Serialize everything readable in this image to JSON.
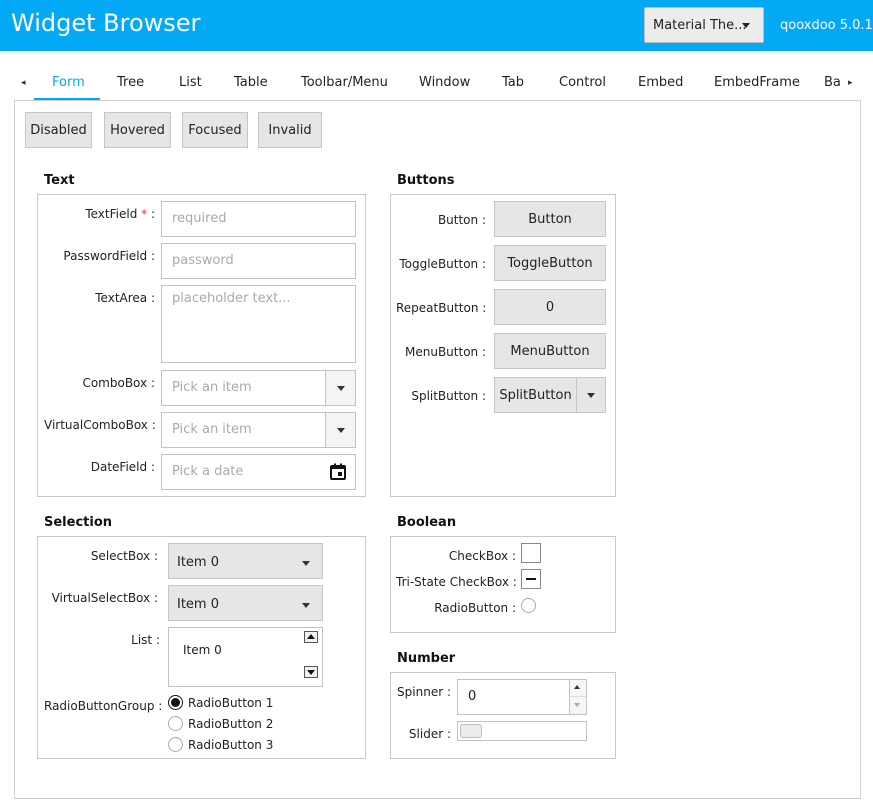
{
  "header": {
    "title": "Widget Browser",
    "theme_select": "Material The...",
    "version": "qooxdoo 5.0.1"
  },
  "tabs": [
    "Form",
    "Tree",
    "List",
    "Table",
    "Toolbar/Menu",
    "Window",
    "Tab",
    "Control",
    "Embed",
    "EmbedFrame",
    "Ba"
  ],
  "tab_scroll": {
    "left": "◂",
    "right": "▸"
  },
  "state_buttons": [
    "Disabled",
    "Hovered",
    "Focused",
    "Invalid"
  ],
  "text_group": {
    "title": "Text",
    "textfield_label": "TextField",
    "required_marker": "*",
    "label_suffix": " :",
    "textfield_placeholder": "required",
    "password_label": "PasswordField :",
    "password_placeholder": "password",
    "textarea_label": "TextArea :",
    "textarea_placeholder": "placeholder text...",
    "combobox_label": "ComboBox :",
    "combobox_placeholder": "Pick an item",
    "virtualcombobox_label": "VirtualComboBox :",
    "virtualcombobox_placeholder": "Pick an item",
    "datefield_label": "DateField :",
    "datefield_placeholder": "Pick a date"
  },
  "buttons_group": {
    "title": "Buttons",
    "button_label": "Button :",
    "button_text": "Button",
    "toggle_label": "ToggleButton :",
    "toggle_text": "ToggleButton",
    "repeat_label": "RepeatButton :",
    "repeat_text": "0",
    "menu_label": "MenuButton :",
    "menu_text": "MenuButton",
    "split_label": "SplitButton :",
    "split_text": "SplitButton"
  },
  "selection_group": {
    "title": "Selection",
    "selectbox_label": "SelectBox :",
    "selectbox_value": "Item 0",
    "virtualselectbox_label": "VirtualSelectBox :",
    "virtualselectbox_value": "Item 0",
    "list_label": "List :",
    "list_item": "Item 0",
    "radiogroup_label": "RadioButtonGroup :",
    "radios": [
      "RadioButton 1",
      "RadioButton 2",
      "RadioButton 3"
    ]
  },
  "boolean_group": {
    "title": "Boolean",
    "checkbox_label": "CheckBox :",
    "tristate_label": "Tri-State CheckBox :",
    "radiobutton_label": "RadioButton :"
  },
  "number_group": {
    "title": "Number",
    "spinner_label": "Spinner :",
    "spinner_value": "0",
    "slider_label": "Slider :"
  },
  "colors": {
    "accent": "#03a9f4",
    "required": "#e53935"
  }
}
